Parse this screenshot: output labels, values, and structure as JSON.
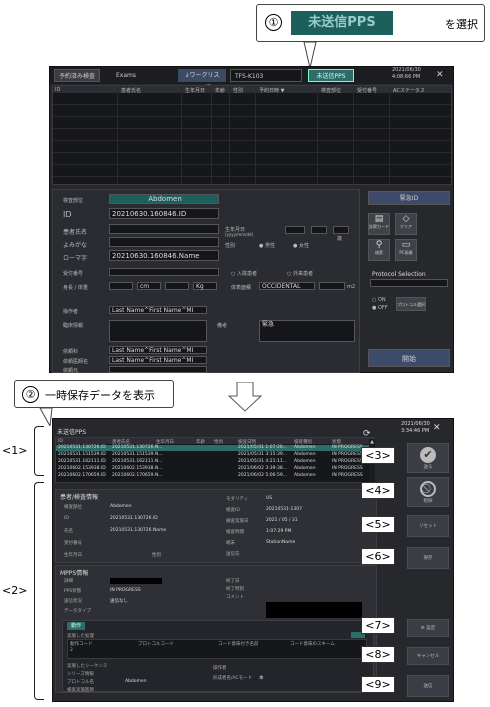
{
  "callout1": {
    "num": "①",
    "pps": "未送信PPS",
    "text": "を選択"
  },
  "callout2": {
    "num": "②",
    "text": "一時保存データを表示"
  },
  "screen1": {
    "tabs": [
      "予約済み検査",
      "Exams"
    ],
    "worklist_btn": "↓ワークリスト取得",
    "device": "TFS-K103",
    "pps_btn": "未送信PPS",
    "date": "2021/06/30",
    "time": "4:08:66 PM",
    "close": "✕",
    "grid_headers": [
      "ID",
      "患者氏名",
      "生年月日",
      "年齢",
      "性別",
      "予約日時 ▼",
      "検査部位",
      "受付番号",
      "ACステータス"
    ],
    "exam_part_label": "検査部位",
    "exam_part_value": "Abdomen",
    "id_label": "ID",
    "id_value": "20210630.160846.ID",
    "name_label": "患者氏名",
    "kana_label": "よみがな",
    "roma_label": "ローマ字",
    "roma_value": "20210630.160846.Name",
    "birth_label": "生年月日",
    "birth_sub": "(yyyy/mm/dd)",
    "sex_label": "性別",
    "male": "男性",
    "female": "女性",
    "age_unit": "歳",
    "accession_label": "受付番号",
    "inpatient": "入院患者",
    "outpatient": "外来患者",
    "height_label": "身長 / 体重",
    "cm": "cm",
    "kg": "Kg",
    "contrast_label": "体表面積",
    "occ_label": "体表面積",
    "occ_value": "OCCIDENTAL",
    "m2": "m2",
    "operator_label": "操作者",
    "operator_value": "Last Name^First Name^MI",
    "clinical_label": "臨床情報",
    "remark_label": "備考",
    "urgent_label": "緊急",
    "req_label": "依頼科",
    "req_doc_label": "依頼医師名",
    "ref_label": "依頼元",
    "req_doc_value": "Last Name^First Name^MI",
    "ref_value": "Last Name^First Name^MI",
    "emergency_id": "緊急ID",
    "btn_card": "診察カード",
    "btn_clear": "クリア",
    "btn_search": "検索",
    "btn_pc": "PC画像",
    "protocol_label": "Protocol Selection",
    "on": "ON",
    "off": "OFF",
    "proto_btn": "プロトコル選択",
    "start": "開始"
  },
  "screen2": {
    "title": "未送信PPS",
    "date": "2021/06/30",
    "time": "3:34:46 PM",
    "close": "✕",
    "headers": [
      "ID",
      "患者氏名",
      "生年月日",
      "年齢",
      "性別",
      "検査日時",
      "検査種別",
      "状態"
    ],
    "rows": [
      [
        "20210531.130726.ID",
        "20210531.130726.N...",
        "",
        "",
        "",
        "2021/05/31 1:07:26...",
        "Abdomen",
        "IN PROGRESS"
      ],
      [
        "20210531.151539.ID",
        "20210531.151539.N...",
        "",
        "",
        "",
        "2021/05/31 3:15:39...",
        "Abdomen",
        "IN PROGRESS"
      ],
      [
        "20210531.162111.ID",
        "20210531.162111.N...",
        "",
        "",
        "",
        "2021/05/31 4:21:11...",
        "Abdomen",
        "IN PROGRESS"
      ],
      [
        "20210602.153938.ID",
        "20210602.153938.N...",
        "",
        "",
        "",
        "2021/06/02 3:39:38...",
        "Abdomen",
        "IN PROGRESS"
      ],
      [
        "20210602.170659.ID",
        "20210602.170659.N...",
        "",
        "",
        "",
        "2021/06/02 5:06:59...",
        "Abdomen",
        "IN PROGRESS"
      ]
    ],
    "patient_section": "患者/検査情報",
    "p_fields": [
      {
        "label": "検査部位",
        "value": "Abdomen"
      },
      {
        "label": "ID",
        "value": "20210531.130726.ID"
      },
      {
        "label": "氏名",
        "value": "20210531.130726.Name"
      },
      {
        "label": "受付番号",
        "value": ""
      },
      {
        "label": "生年月日",
        "value": ""
      }
    ],
    "sex_label": "性別",
    "p_fields_right": [
      {
        "label": "モダリティ",
        "value": "US"
      },
      {
        "label": "検査ID",
        "value": "20210531-1307"
      },
      {
        "label": "検査実施日",
        "value": "2021 / 05 / 31"
      },
      {
        "label": "検査時間",
        "value": "1:07:29 PM"
      },
      {
        "label": "端末",
        "value": "StationName"
      },
      {
        "label": "送信先",
        "value": ""
      }
    ],
    "mpps_section": "MPPS情報",
    "m_fields": [
      {
        "label": "詳細",
        "value": ""
      },
      {
        "label": "PPS状態",
        "value": "IN PROGRESS"
      },
      {
        "label": "送信状況",
        "value": "送信なし"
      },
      {
        "label": "データタイプ",
        "value": ""
      }
    ],
    "m_fields_right": [
      {
        "label": "終了日",
        "value": ""
      },
      {
        "label": "終了時刻",
        "value": ""
      },
      {
        "label": "コメント",
        "value": ""
      }
    ],
    "action_tab": "動作",
    "action_label": "実施した処理",
    "action_cols": [
      "動作コード",
      "プロトコルコード",
      "コード意味付き名前",
      "コード意味のスキーム"
    ],
    "action_row": "2",
    "detail_rows": [
      {
        "label": "実施したシーケンス",
        "value": ""
      },
      {
        "label": "シリーズ情報",
        "value": ""
      },
      {
        "label": "プロトコル名",
        "value": "Abdomen"
      },
      {
        "label": "検査実施医師",
        "value": ""
      }
    ],
    "detail_right": [
      {
        "label": "操作者",
        "value": ""
      },
      {
        "label": "形成者名/ACモード",
        "value": "本"
      }
    ],
    "btn_send_check": "送る",
    "btn_delete": "削除",
    "btn_reset": "リセット",
    "btn_save": "保存",
    "btn_settings": "設定",
    "btn_cancel": "キャンセル",
    "btn_send": "送信"
  },
  "tags": {
    "t1": "<1>",
    "t2": "<2>",
    "t3": "<3>",
    "t4": "<4>",
    "t5": "<5>",
    "t6": "<6>",
    "t7": "<7>",
    "t8": "<8>",
    "t9": "<9>"
  }
}
